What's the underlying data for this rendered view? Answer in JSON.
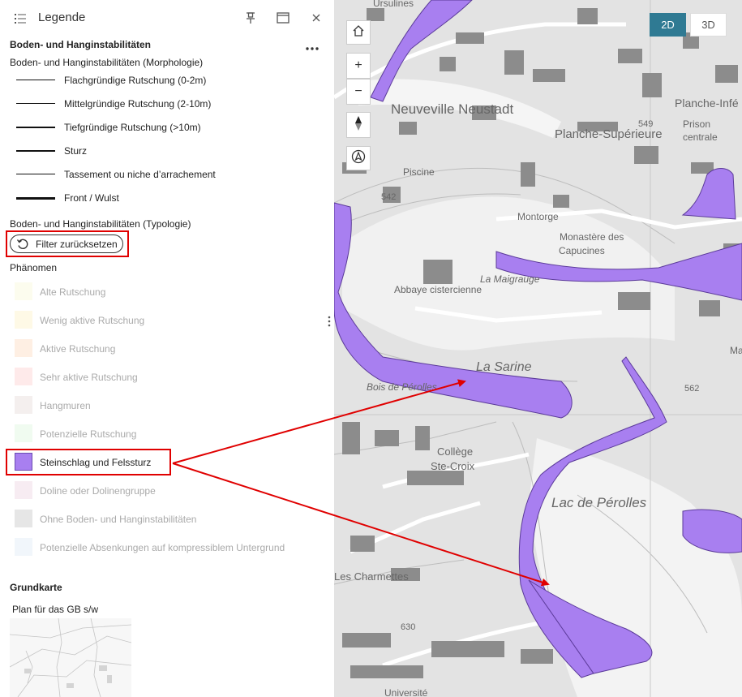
{
  "header": {
    "title": "Legende"
  },
  "morphology": {
    "section_title": "Boden- und Hanginstabilitäten",
    "subtitle": "Boden- und Hanginstabilitäten (Morphologie)",
    "items": [
      {
        "label": "Flachgründige Rutschung (0-2m)"
      },
      {
        "label": "Mittelgründige Rutschung (2-10m)"
      },
      {
        "label": "Tiefgründige Rutschung (>10m)"
      },
      {
        "label": "Sturz"
      },
      {
        "label": "Tassement ou niche d’arrachement"
      },
      {
        "label": "Front / Wulst"
      }
    ]
  },
  "typology": {
    "subtitle": "Boden- und Hanginstabilitäten (Typologie)",
    "reset_label": "Filter zurücksetzen",
    "group_label": "Phänomen",
    "items": [
      {
        "label": "Alte Rutschung",
        "color": "#fcfcee",
        "active": false
      },
      {
        "label": "Wenig aktive Rutschung",
        "color": "#fef9e6",
        "active": false
      },
      {
        "label": "Aktive Rutschung",
        "color": "#feefe3",
        "active": false
      },
      {
        "label": "Sehr aktive Rutschung",
        "color": "#feeaea",
        "active": false
      },
      {
        "label": "Hangmuren",
        "color": "#f4efee",
        "active": false
      },
      {
        "label": "Potenzielle Rutschung",
        "color": "#f0fbf0",
        "active": false
      },
      {
        "label": "Steinschlag und Felssturz",
        "color": "#a87ff0",
        "active": true
      },
      {
        "label": "Doline oder Dolinengruppe",
        "color": "#f7ecf2",
        "active": false
      },
      {
        "label": "Ohne Boden- und Hanginstabilitäten",
        "color": "#e6e6e6",
        "active": false
      },
      {
        "label": "Potenzielle Absenkungen auf kompressiblem Untergrund",
        "color": "#f1f6fb",
        "active": false
      }
    ]
  },
  "basemap": {
    "section_title": "Grundkarte",
    "name": "Plan für das GB s/w"
  },
  "map": {
    "view_2d": "2D",
    "view_3d": "3D",
    "labels": {
      "ursulines": "Ursulines",
      "neuveville": "Neuveville Neustadt",
      "planche_inf": "Planche-Infé",
      "planche_sup": "Planche-Supérieure",
      "h549": "549",
      "prison": "Prison",
      "centrale": "centrale",
      "piscine": "Piscine",
      "h542": "542",
      "montorge": "Montorge",
      "monastere": "Monastère des",
      "capucines": "Capucines",
      "abbaye": "Abbaye cistercienne",
      "maigrauge": "La Maigrauge",
      "sarine": "La Sarine",
      "bois": "Bois de Pérolles",
      "h562": "562",
      "college": "Collège",
      "stecroix": "Ste-Croix",
      "lac": "Lac de Pérolles",
      "charmettes": "Les Charmettes",
      "h630": "630",
      "universite": "Université",
      "ma": "Ma"
    },
    "fill_color": "#a87ff0",
    "arrow_color": "#e00000"
  }
}
